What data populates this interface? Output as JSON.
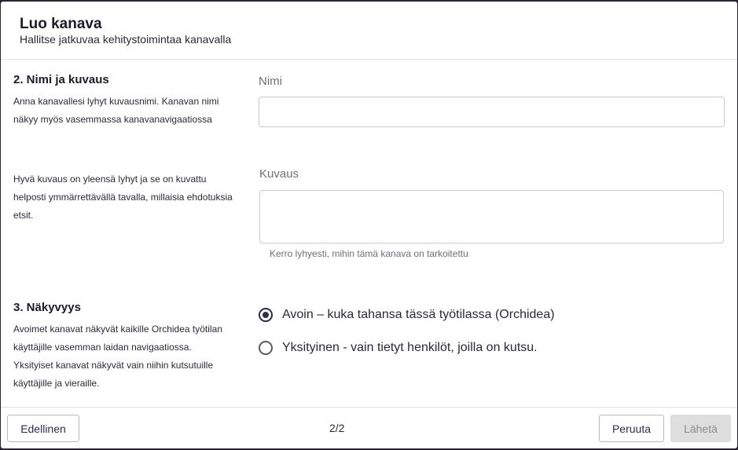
{
  "dialog": {
    "title": "Luo kanava",
    "subtitle": "Hallitse jatkuvaa kehitystoimintaa kanavalla"
  },
  "section_name": {
    "heading": "2. Nimi ja kuvaus",
    "name_description": "Anna kanavallesi lyhyt kuvausnimi. Kanavan nimi näkyy myös vasemmassa kanavanavigaatiossa",
    "description_help": "Hyvä kuvaus on yleensä lyhyt ja se on kuvattu helposti ymmärrettävällä tavalla, millaisia ehdotuksia etsit.",
    "name_label": "Nimi",
    "name_value": "",
    "description_label": "Kuvaus",
    "description_value": "",
    "description_helper": "Kerro lyhyesti, mihin tämä kanava on tarkoitettu"
  },
  "section_visibility": {
    "heading": "3. Näkyvyys",
    "description": "Avoimet kanavat näkyvät kaikille Orchidea työtilan käyttäjille vasemman laidan navigaatiossa. Yksityiset kanavat näkyvät vain niihin kutsutuille käyttäjille ja vieraille.",
    "options": [
      {
        "label": "Avoin – kuka tahansa tässä työtilassa (Orchidea)",
        "selected": true
      },
      {
        "label": "Yksityinen - vain tietyt henkilöt, joilla on kutsu.",
        "selected": false
      }
    ]
  },
  "footer": {
    "previous_label": "Edellinen",
    "page_indicator": "2/2",
    "cancel_label": "Peruuta",
    "submit_label": "Lähetä",
    "submit_disabled": true
  },
  "colors": {
    "accent": "#2b2d4a",
    "disabled_bg": "#dedede"
  }
}
